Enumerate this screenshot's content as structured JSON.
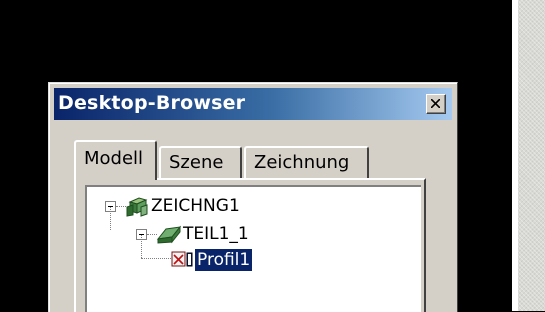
{
  "window": {
    "title": "Desktop-Browser",
    "close_icon": "close-icon"
  },
  "tabs": [
    {
      "label": "Modell",
      "active": true
    },
    {
      "label": "Szene",
      "active": false
    },
    {
      "label": "Zeichnung",
      "active": false
    }
  ],
  "tree": {
    "items": [
      {
        "label": "ZEICHNG1",
        "icon": "drawing-assembly-icon",
        "expanded": true,
        "level": 0
      },
      {
        "label": "TEIL1_1",
        "icon": "part-icon",
        "expanded": true,
        "level": 1
      },
      {
        "label": "Profil1",
        "icon": "profile-icon",
        "selected": true,
        "level": 2
      }
    ]
  },
  "colors": {
    "titlebar_start": "#0a246a",
    "titlebar_end": "#a6caf0",
    "selection": "#0a246a",
    "dialog_face": "#d4d0c8"
  }
}
